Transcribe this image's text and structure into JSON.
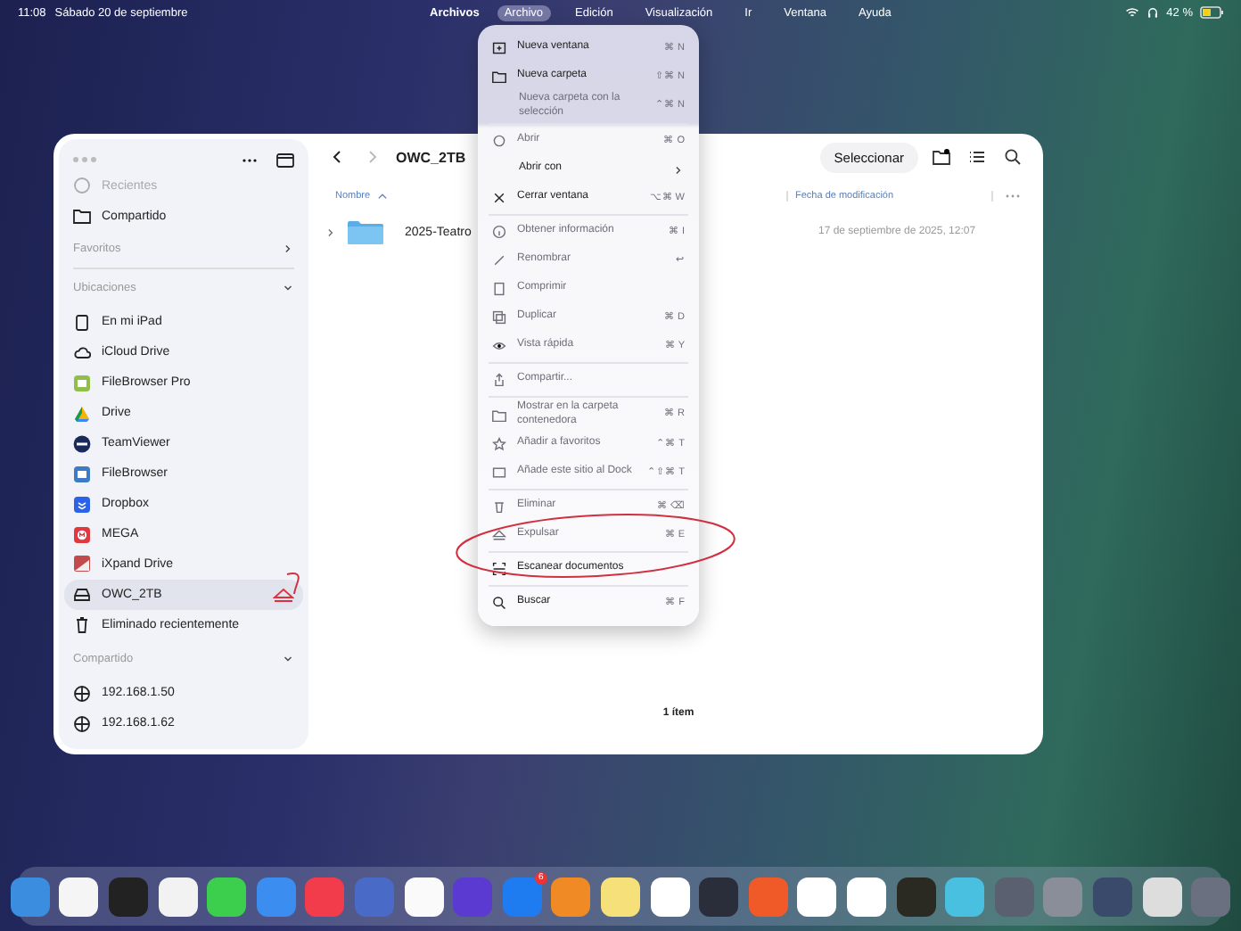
{
  "menu_bar": {
    "time": "11:08",
    "date": "Sábado 20 de septiembre",
    "app_name": "Archivos",
    "menus": [
      {
        "label": "Archivo",
        "selected": true
      },
      {
        "label": "Edición",
        "selected": false
      },
      {
        "label": "Visualización",
        "selected": false
      },
      {
        "label": "Ir",
        "selected": false
      },
      {
        "label": "Ventana",
        "selected": false
      },
      {
        "label": "Ayuda",
        "selected": false
      }
    ],
    "battery": "42 %"
  },
  "window": {
    "sidebar": {
      "top_items": [
        {
          "label": "Recientes",
          "disabled": true
        },
        {
          "label": "Compartido",
          "disabled": false
        }
      ],
      "sections": [
        {
          "title": "Favoritos",
          "expanded": false
        },
        {
          "title": "Ubicaciones",
          "expanded": true,
          "items": [
            {
              "label": "En mi iPad",
              "selected": false
            },
            {
              "label": "iCloud Drive",
              "selected": false
            },
            {
              "label": "FileBrowser Pro",
              "selected": false
            },
            {
              "label": "Drive",
              "selected": false
            },
            {
              "label": "TeamViewer",
              "selected": false
            },
            {
              "label": "FileBrowser",
              "selected": false
            },
            {
              "label": "Dropbox",
              "selected": false
            },
            {
              "label": "MEGA",
              "selected": false
            },
            {
              "label": "iXpand Drive",
              "selected": false
            },
            {
              "label": "OWC_2TB",
              "selected": true
            },
            {
              "label": "Eliminado recientemente",
              "selected": false
            }
          ]
        },
        {
          "title": "Compartido",
          "expanded": true,
          "items": [
            {
              "label": "192.168.1.50",
              "selected": false
            },
            {
              "label": "192.168.1.62",
              "selected": false
            }
          ]
        }
      ]
    },
    "toolbar": {
      "title": "OWC_2TB",
      "select_button": "Seleccionar"
    },
    "table": {
      "columns": [
        {
          "label": "Nombre",
          "sorted": true
        },
        {
          "label": "Fecha de modificación",
          "sorted": false
        }
      ],
      "rows": [
        {
          "name": "2025-Teatro",
          "date": "17 de septiembre de 2025, 12:07",
          "expanded": false
        }
      ]
    },
    "status_bar": "1 ítem"
  },
  "file_menu": {
    "groups": [
      [
        {
          "label": "Nueva ventana",
          "shortcut": "⌘ N",
          "disabled": false,
          "kind": "item"
        },
        {
          "label": "Nueva carpeta",
          "shortcut": "⇧⌘ N",
          "disabled": false,
          "kind": "item"
        },
        {
          "label": "Nueva carpeta con la selección",
          "shortcut": "⌃⌘ N",
          "disabled": true,
          "kind": "item"
        }
      ],
      [
        {
          "label": "Abrir",
          "shortcut": "⌘ O",
          "disabled": true,
          "kind": "item"
        },
        {
          "label": "Abrir con",
          "disabled": false,
          "kind": "submenu"
        },
        {
          "label": "Cerrar ventana",
          "shortcut": "⌥⌘ W",
          "disabled": false,
          "kind": "item"
        }
      ],
      [
        {
          "label": "Obtener información",
          "shortcut": "⌘ I",
          "disabled": true,
          "kind": "item"
        },
        {
          "label": "Renombrar",
          "shortcut": "↩",
          "disabled": true,
          "kind": "item"
        },
        {
          "label": "Comprimir",
          "disabled": true,
          "kind": "item"
        },
        {
          "label": "Duplicar",
          "shortcut": "⌘ D",
          "disabled": true,
          "kind": "item"
        },
        {
          "label": "Vista rápida",
          "shortcut": "⌘ Y",
          "disabled": true,
          "kind": "item"
        }
      ],
      [
        {
          "label": "Compartir...",
          "disabled": true,
          "kind": "item"
        }
      ],
      [
        {
          "label": "Mostrar en la carpeta contenedora",
          "shortcut": "⌘ R",
          "disabled": true,
          "kind": "item"
        },
        {
          "label": "Añadir a favoritos",
          "shortcut": "⌃⌘ T",
          "disabled": true,
          "kind": "item"
        },
        {
          "label": "Añade este sitio al Dock",
          "shortcut": "⌃⇧⌘ T",
          "disabled": true,
          "kind": "item"
        }
      ],
      [
        {
          "label": "Eliminar",
          "shortcut": "⌘ ⌫",
          "disabled": true,
          "kind": "item"
        },
        {
          "label": "Expulsar",
          "shortcut": "⌘ E",
          "disabled": true,
          "kind": "item"
        }
      ],
      [
        {
          "label": "Escanear documentos",
          "disabled": false,
          "kind": "item"
        }
      ],
      [
        {
          "label": "Buscar",
          "shortcut": "⌘ F",
          "disabled": false,
          "kind": "item"
        }
      ]
    ]
  },
  "dock": {
    "badge": "6"
  }
}
